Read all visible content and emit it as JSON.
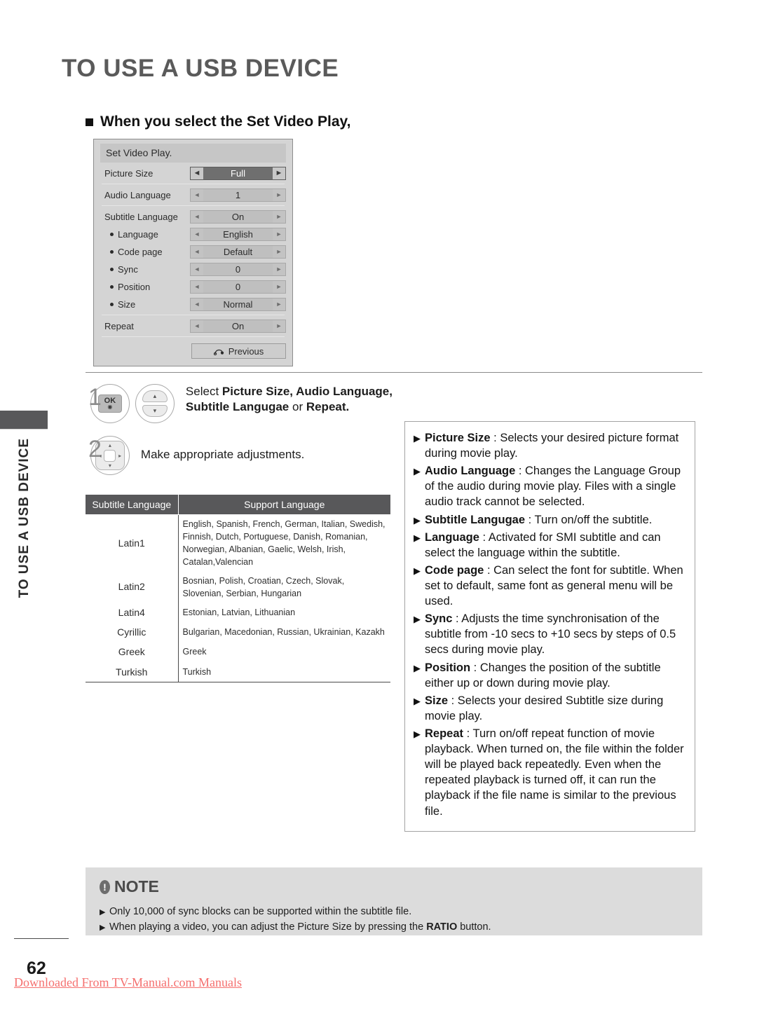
{
  "page": {
    "title": "TO USE A USB DEVICE",
    "section_heading": "When you select the Set Video Play,",
    "side_tab_label": "TO USE A USB DEVICE",
    "page_number": "62",
    "footer_link": "Downloaded From TV-Manual.com Manuals"
  },
  "osd": {
    "title": "Set Video Play.",
    "left_arrow": "◄",
    "right_arrow": "►",
    "rows": [
      {
        "label": "Picture Size",
        "value": "Full",
        "highlighted": true,
        "sub": false
      },
      {
        "label": "Audio Language",
        "value": "1",
        "highlighted": false,
        "sub": false
      },
      {
        "label": "Subtitle Language",
        "value": "On",
        "highlighted": false,
        "sub": false
      },
      {
        "label": "Language",
        "value": "English",
        "highlighted": false,
        "sub": true
      },
      {
        "label": "Code page",
        "value": "Default",
        "highlighted": false,
        "sub": true
      },
      {
        "label": "Sync",
        "value": "0",
        "highlighted": false,
        "sub": true
      },
      {
        "label": "Position",
        "value": "0",
        "highlighted": false,
        "sub": true
      },
      {
        "label": "Size",
        "value": "Normal",
        "highlighted": false,
        "sub": true
      },
      {
        "label": "Repeat",
        "value": "On",
        "highlighted": false,
        "sub": false
      }
    ],
    "previous_button": "Previous"
  },
  "steps": {
    "one": {
      "number": "1",
      "ok_label": "OK",
      "line1_prefix": "Select ",
      "line1_bold": "Picture Size, Audio Language,",
      "line2_bold1": "Subtitle Langugae",
      "line2_mid": " or ",
      "line2_bold2": "Repeat."
    },
    "two": {
      "number": "2",
      "text": "Make appropriate adjustments."
    }
  },
  "subtitle_table": {
    "headers": [
      "Subtitle Language",
      "Support Language"
    ],
    "rows": [
      {
        "name": "Latin1",
        "support": "English, Spanish, French, German, Italian, Swedish, Finnish, Dutch, Portuguese, Danish, Romanian, Norwegian, Albanian, Gaelic, Welsh, Irish, Catalan,Valencian"
      },
      {
        "name": "Latin2",
        "support": "Bosnian, Polish, Croatian, Czech, Slovak, Slovenian, Serbian, Hungarian"
      },
      {
        "name": "Latin4",
        "support": "Estonian, Latvian, Lithuanian"
      },
      {
        "name": "Cyrillic",
        "support": "Bulgarian, Macedonian, Russian, Ukrainian, Kazakh"
      },
      {
        "name": "Greek",
        "support": "Greek"
      },
      {
        "name": "Turkish",
        "support": "Turkish"
      }
    ]
  },
  "descriptions": {
    "bullet": "▶",
    "items": [
      {
        "term": "Picture Size",
        "sep": " : ",
        "text": "Selects your desired picture format during movie play."
      },
      {
        "term": "Audio Language",
        "sep": " : ",
        "text": "Changes the Language Group of the audio during movie play. Files with a single audio track cannot be selected."
      },
      {
        "term": "Subtitle Langugae",
        "sep": " : ",
        "text": "Turn on/off the subtitle."
      },
      {
        "term": "Language",
        "sep": " : ",
        "text": "Activated for SMI subtitle and can select the language within the subtitle."
      },
      {
        "term": "Code page",
        "sep": " : ",
        "text": "Can select the font for subtitle. When set to default, same font as general menu will be used."
      },
      {
        "term": "Sync",
        "sep": " : ",
        "text": "Adjusts the time synchronisation of the subtitle from -10 secs to +10 secs by steps of 0.5 secs during movie play."
      },
      {
        "term": "Position",
        "sep": " : ",
        "text": "Changes the position of the subtitle either up or down during movie play."
      },
      {
        "term": "Size",
        "sep": " : ",
        "text": "Selects your desired Subtitle size during movie play."
      },
      {
        "term": "Repeat",
        "sep": " : ",
        "text": "Turn on/off repeat function of movie playback. When turned on, the file within the folder will be played back repeatedly. Even when the repeated playback is turned off, it can run the playback if the file name is similar to the previous file."
      }
    ]
  },
  "note": {
    "heading": "NOTE",
    "bullet": "▶",
    "lines": [
      {
        "pre": "Only 10,000 of sync blocks can be supported within the subtitle file.",
        "bold": "",
        "post": ""
      },
      {
        "pre": "When playing a video, you can adjust the Picture Size by pressing the ",
        "bold": "RATIO",
        "post": " button."
      }
    ]
  },
  "colors": {
    "title_gray": "#5a5a5a",
    "tab_dark": "#58585a",
    "osd_bg": "#d4d4d4",
    "osd_highlight": "#6f6f6f",
    "note_bg": "#dcdcdc",
    "footer_red": "#f5706f"
  }
}
